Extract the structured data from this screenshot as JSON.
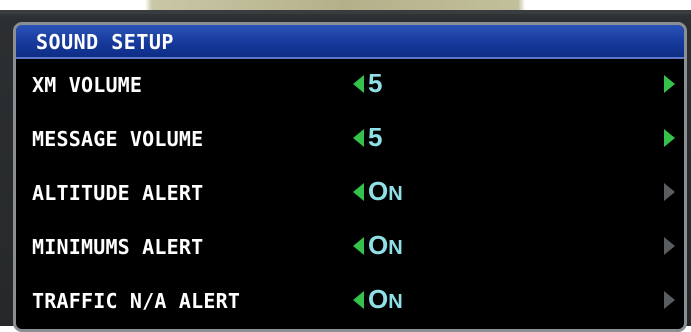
{
  "window": {
    "title": "SOUND SETUP"
  },
  "settings": [
    {
      "label": "XM VOLUME",
      "value": "5",
      "right_arrow_enabled": true
    },
    {
      "label": "MESSAGE VOLUME",
      "value": "5",
      "right_arrow_enabled": true
    },
    {
      "label": "ALTITUDE ALERT",
      "value_first": "O",
      "value_rest": "N",
      "right_arrow_enabled": false
    },
    {
      "label": "MINIMUMS ALERT",
      "value_first": "O",
      "value_rest": "N",
      "right_arrow_enabled": false
    },
    {
      "label": "TRAFFIC N/A ALERT",
      "value_first": "O",
      "value_rest": "N",
      "right_arrow_enabled": false
    }
  ],
  "colors": {
    "title_bar": "#163a9c",
    "value_text": "#8fe0e6",
    "arrow_enabled": "#34c24a",
    "arrow_disabled": "#5a5d60"
  },
  "icons": {
    "left_arrow": "triangle-left-icon",
    "right_arrow": "triangle-right-icon"
  }
}
